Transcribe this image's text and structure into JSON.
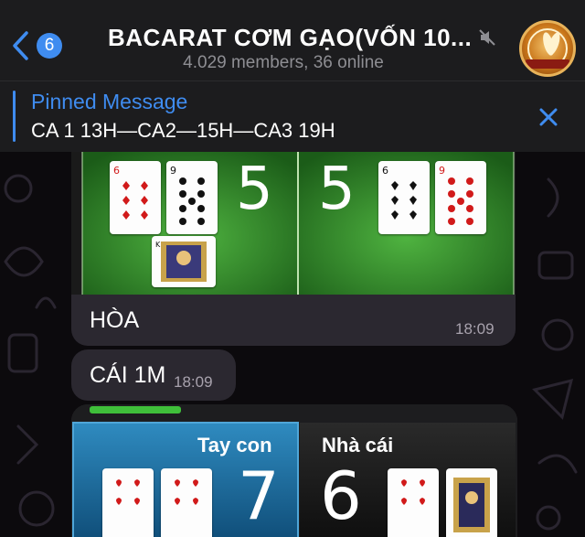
{
  "header": {
    "back_count": "6",
    "title": "BACARAT CƠM GẠO(VỐN 10...",
    "subtitle": "4.029 members, 36 online"
  },
  "pinned": {
    "label": "Pinned Message",
    "text": "CA 1 13H—CA2—15H—CA3 19H"
  },
  "messages": [
    {
      "text": "HÒA",
      "time": "18:09"
    },
    {
      "text": "CÁI 1M",
      "time": "18:09"
    }
  ],
  "game1": {
    "player_score": "5",
    "banker_score": "5"
  },
  "game2": {
    "player_label": "Tay con",
    "banker_label": "Nhà cái",
    "player_score": "7",
    "banker_score": "6"
  },
  "colors": {
    "accent": "#3f8cf0",
    "header_bg": "#1c1c1e",
    "bubble_bg": "#2b2830",
    "table_green": "#2f8a2c",
    "table_blue": "#1f6fa0"
  }
}
